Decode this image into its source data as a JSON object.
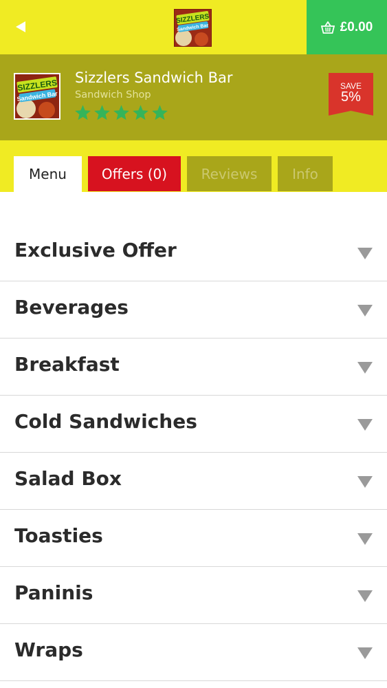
{
  "header": {
    "back_icon": "back-arrow-icon",
    "basket_total": "£0.00",
    "basket_icon": "basket-icon"
  },
  "restaurant": {
    "name": "Sizzlers Sandwich Bar",
    "type": "Sandwich Shop",
    "logo_text_line1": "SIZZLERS",
    "logo_text_line2": "Sandwich Bar",
    "rating_stars": 5,
    "save_label": "SAVE",
    "save_percent": "5%"
  },
  "tabs": [
    {
      "label": "Menu",
      "active": true
    },
    {
      "label": "Offers (0)",
      "active": false
    },
    {
      "label": "Reviews",
      "active": false
    },
    {
      "label": "Info",
      "active": false
    }
  ],
  "menu": {
    "categories": [
      {
        "label": "Exclusive Offer"
      },
      {
        "label": "Beverages"
      },
      {
        "label": "Breakfast"
      },
      {
        "label": "Cold Sandwiches"
      },
      {
        "label": "Salad Box"
      },
      {
        "label": "Toasties"
      },
      {
        "label": "Paninis"
      },
      {
        "label": "Wraps"
      }
    ]
  },
  "colors": {
    "top_bar": "#f0eb23",
    "header_band": "#a9a61a",
    "basket": "#35c458",
    "offers_tab": "#d7121f",
    "star": "#35b45a"
  }
}
